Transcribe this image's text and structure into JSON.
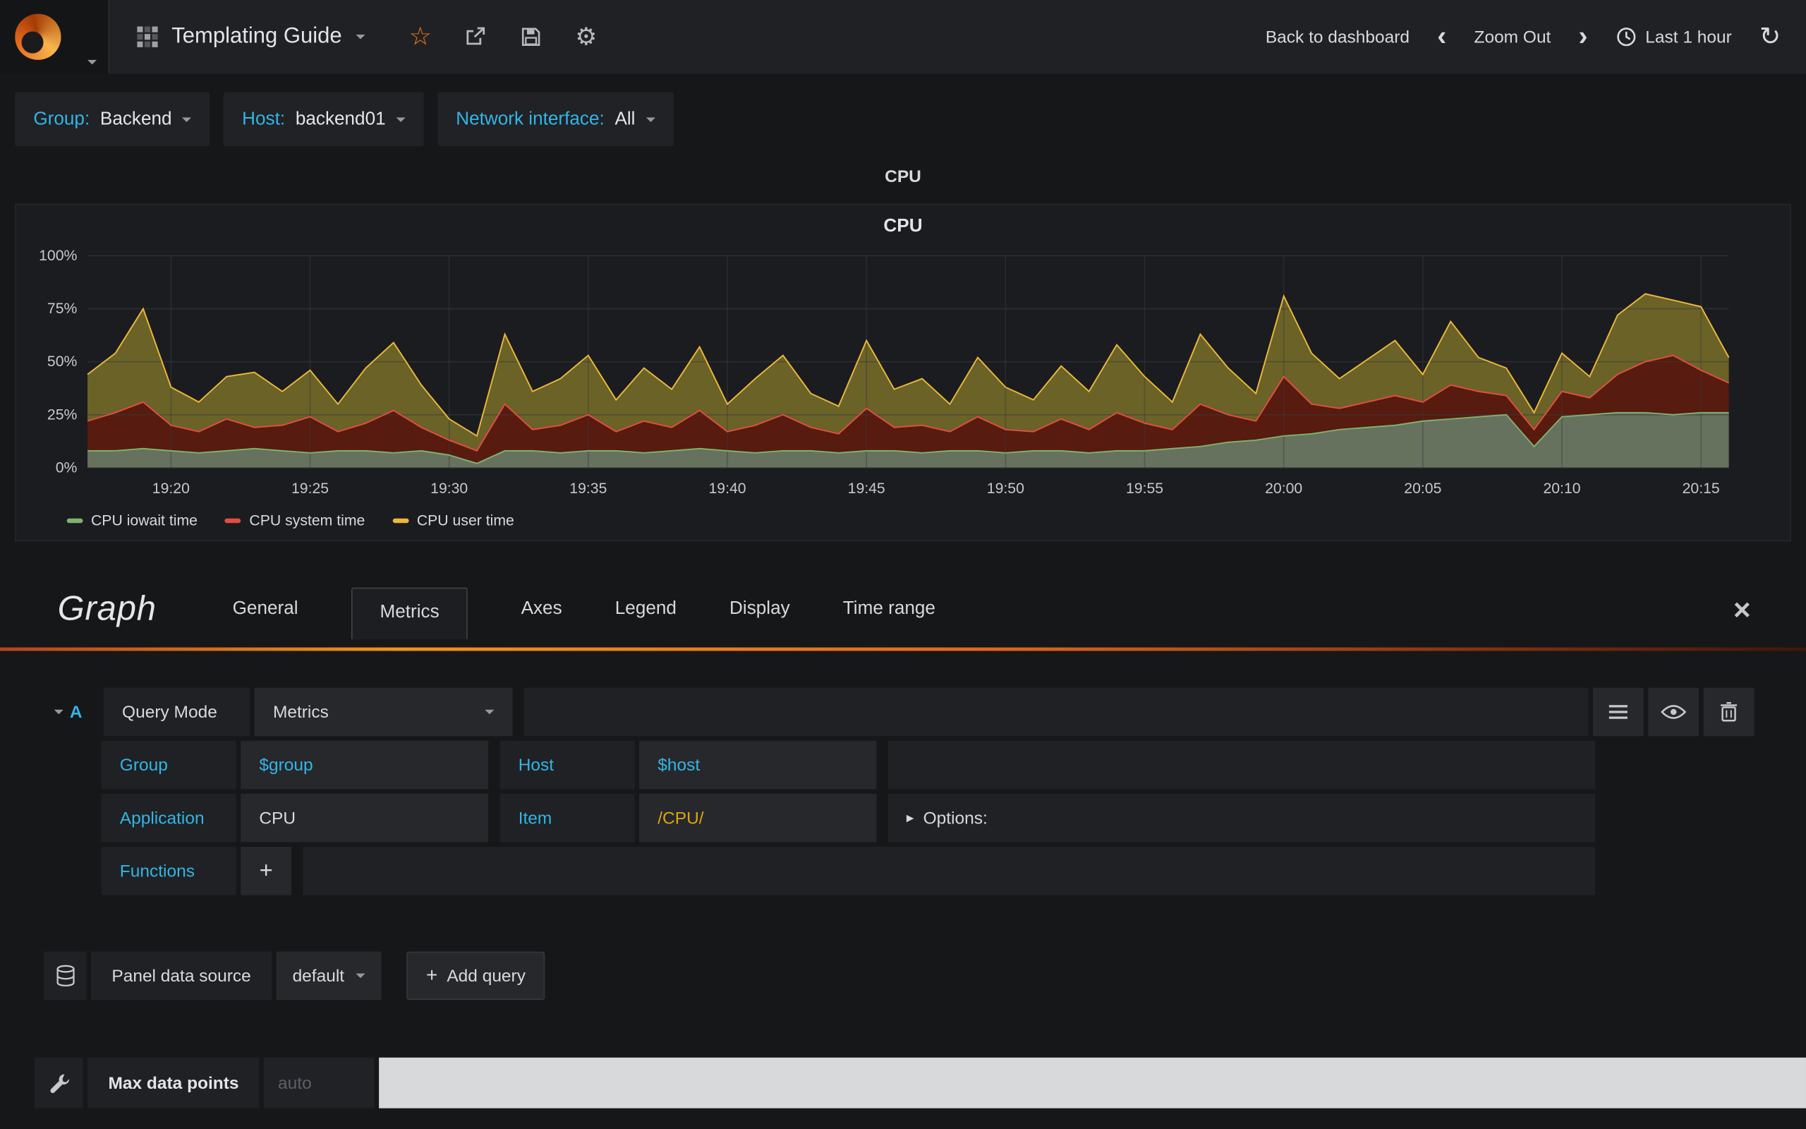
{
  "navbar": {
    "title": "Templating Guide",
    "back_to_dashboard": "Back to dashboard",
    "zoom_out": "Zoom Out",
    "time_range": "Last 1 hour"
  },
  "icons": {
    "star": "☆",
    "gear": "⚙",
    "refresh": "↻",
    "chevron_left": "‹",
    "chevron_right": "›",
    "close": "×",
    "options_caret": "▸",
    "plus": "+"
  },
  "variables": [
    {
      "label": "Group:",
      "value": "Backend"
    },
    {
      "label": "Host:",
      "value": "backend01"
    },
    {
      "label": "Network interface:",
      "value": "All"
    }
  ],
  "panel": {
    "title": "CPU"
  },
  "chart_data": {
    "type": "area",
    "stacked": true,
    "title": "CPU",
    "ylim": [
      0,
      100
    ],
    "y_ticks": [
      {
        "label": "0%",
        "value": 0
      },
      {
        "label": "25%",
        "value": 25
      },
      {
        "label": "50%",
        "value": 50
      },
      {
        "label": "75%",
        "value": 75
      },
      {
        "label": "100%",
        "value": 100
      }
    ],
    "x_start": "19:17",
    "x_end": "20:16",
    "x_step_minutes": 1,
    "x_ticks": [
      {
        "label": "19:20",
        "minute": 3
      },
      {
        "label": "19:25",
        "minute": 8
      },
      {
        "label": "19:30",
        "minute": 13
      },
      {
        "label": "19:35",
        "minute": 18
      },
      {
        "label": "19:40",
        "minute": 23
      },
      {
        "label": "19:45",
        "minute": 28
      },
      {
        "label": "19:50",
        "minute": 33
      },
      {
        "label": "19:55",
        "minute": 38
      },
      {
        "label": "20:00",
        "minute": 43
      },
      {
        "label": "20:05",
        "minute": 48
      },
      {
        "label": "20:10",
        "minute": 53
      },
      {
        "label": "20:15",
        "minute": 58
      }
    ],
    "legend_position": "bottom",
    "series": [
      {
        "name": "CPU iowait time",
        "line_color": "#7eb26d",
        "fill_color": "#66715e",
        "values": [
          8,
          8,
          9,
          8,
          7,
          8,
          9,
          8,
          7,
          8,
          8,
          7,
          8,
          6,
          2,
          8,
          8,
          7,
          8,
          8,
          7,
          8,
          9,
          8,
          7,
          8,
          8,
          7,
          8,
          8,
          7,
          8,
          8,
          7,
          8,
          8,
          7,
          8,
          8,
          9,
          10,
          12,
          13,
          15,
          16,
          18,
          19,
          20,
          22,
          23,
          24,
          25,
          10,
          24,
          25,
          26,
          26,
          25,
          26,
          26
        ]
      },
      {
        "name": "CPU system time",
        "line_color": "#e24d42",
        "fill_color": "#571b0f",
        "values": [
          14,
          18,
          22,
          12,
          10,
          15,
          10,
          12,
          17,
          9,
          13,
          20,
          11,
          7,
          6,
          22,
          10,
          13,
          17,
          9,
          15,
          11,
          18,
          9,
          13,
          17,
          11,
          9,
          20,
          11,
          13,
          9,
          16,
          11,
          9,
          15,
          11,
          18,
          13,
          9,
          20,
          13,
          9,
          28,
          14,
          10,
          12,
          14,
          9,
          16,
          12,
          9,
          8,
          12,
          8,
          18,
          24,
          28,
          20,
          14
        ]
      },
      {
        "name": "CPU user time",
        "line_color": "#eab839",
        "fill_color": "#6a6227",
        "values": [
          22,
          28,
          44,
          18,
          14,
          20,
          26,
          16,
          22,
          13,
          26,
          32,
          20,
          10,
          7,
          33,
          18,
          22,
          28,
          15,
          25,
          18,
          30,
          13,
          22,
          28,
          16,
          13,
          32,
          18,
          22,
          13,
          28,
          20,
          15,
          25,
          18,
          32,
          22,
          13,
          33,
          22,
          13,
          38,
          24,
          14,
          20,
          26,
          13,
          30,
          16,
          13,
          8,
          18,
          10,
          28,
          32,
          26,
          30,
          12
        ]
      }
    ]
  },
  "editor": {
    "name": "Graph",
    "tabs": [
      "General",
      "Metrics",
      "Axes",
      "Legend",
      "Display",
      "Time range"
    ],
    "active_tab": "Metrics",
    "query": {
      "letter": "A",
      "query_mode_label": "Query Mode",
      "query_mode_value": "Metrics",
      "row_group": {
        "label": "Group",
        "value": "$group",
        "label2": "Host",
        "value2": "$host"
      },
      "row_app": {
        "label": "Application",
        "value": "CPU",
        "label2": "Item",
        "value2": "/CPU/",
        "options_label": "Options:"
      },
      "row_functions": {
        "label": "Functions"
      }
    },
    "datasource": {
      "label": "Panel data source",
      "value": "default",
      "add_query_label": "Add query"
    },
    "max_data_points": {
      "label": "Max data points",
      "placeholder": "auto"
    }
  },
  "colors": {
    "accent_cyan": "#33b5e5",
    "accent_orange": "#eb7b18",
    "item_yellow": "#d9a60e",
    "background": "#161719",
    "cell_bg": "#1f2124"
  }
}
